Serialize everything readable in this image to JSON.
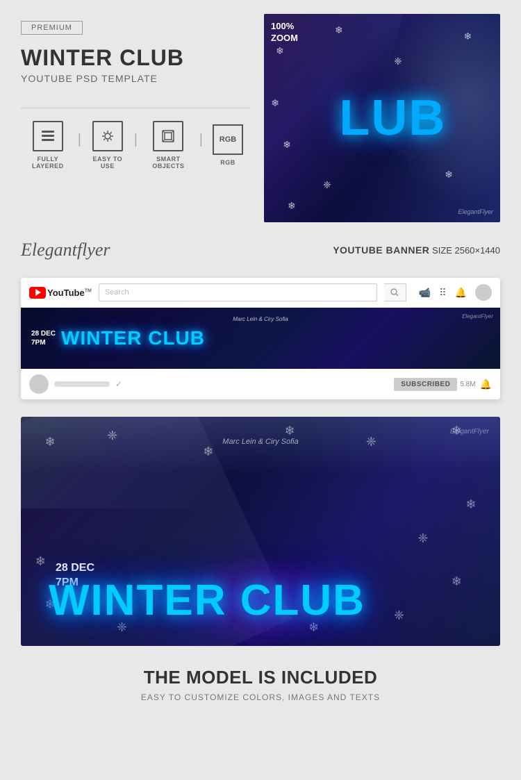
{
  "badge": {
    "label": "PREMIUM"
  },
  "header": {
    "title": "WINTER CLUB",
    "subtitle": "YOUTUBE PSD TEMPLATE"
  },
  "features": [
    {
      "label": "FULLY LAYERED",
      "icon": "layers"
    },
    {
      "label": "EASY TO USE",
      "icon": "wand"
    },
    {
      "label": "SMART OBJECTS",
      "icon": "smartobj"
    },
    {
      "label": "RGB",
      "icon": "rgb"
    }
  ],
  "preview": {
    "zoom_label": "100%\nZOOM",
    "zoom_line1": "100%",
    "zoom_line2": "ZOOM",
    "club_text": "LUB",
    "watermark": "ElegantFlyer"
  },
  "brand": {
    "name": "Elegantflyer",
    "banner_label": "YOUTUBE BANNER",
    "banner_size": "SIZE 2560×1440"
  },
  "youtube_mockup": {
    "logo_text": "YouTube",
    "logo_super": "TM",
    "search_placeholder": "Search",
    "banner_date_line1": "28 DEC",
    "banner_date_line2": "7PM",
    "banner_title": "WINTER CLUB",
    "banner_subtitle": "Marc Lein & Ciry Sofia",
    "watermark": "ElegantFlyer",
    "subscribe_label": "SUBSCRIBED",
    "sub_count": "5.8M"
  },
  "large_banner": {
    "date_line1": "28 DEC",
    "date_line2": "7PM",
    "title": "WINTER CLUB",
    "subtitle": "Marc Lein & Ciry Sofia",
    "watermark": "ElegantFlyer"
  },
  "footer": {
    "main_text": "THE MODEL IS INCLUDED",
    "sub_text": "EASY TO CUSTOMIZE COLORS, IMAGES AND TEXTS"
  }
}
